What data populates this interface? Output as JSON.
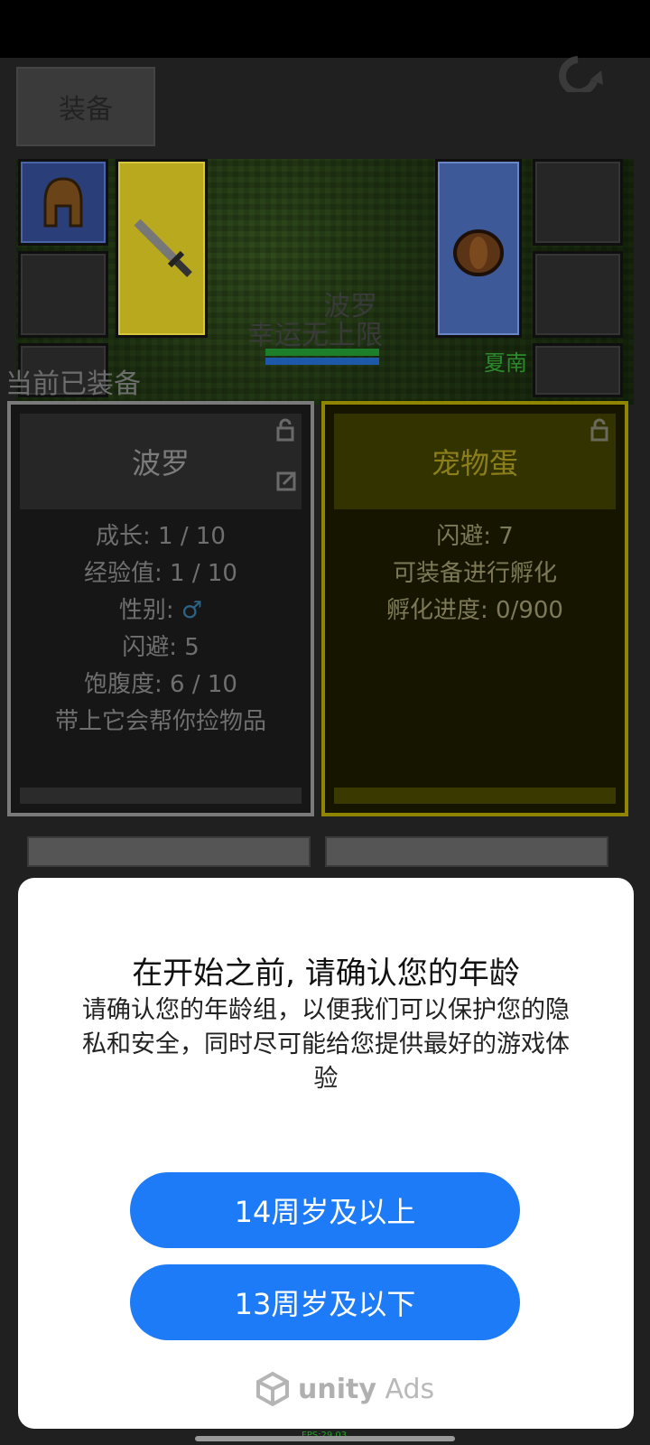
{
  "header": {
    "equip_tab_label": "装备"
  },
  "scene": {
    "pet_name": "波罗",
    "player_title": "幸运无上限",
    "npc_name": "夏南"
  },
  "equipped_label": "当前已装备",
  "pet_card": {
    "title": "波罗",
    "lines": [
      "成长: 1 / 10",
      "经验值: 1 / 10",
      "性别: ",
      "闪避: 5",
      "饱腹度: 6 / 10",
      "带上它会帮你捡物品"
    ],
    "gender_symbol": "♂"
  },
  "egg_card": {
    "title": "宠物蛋",
    "lines": [
      "闪避: 7",
      "可装备进行孵化",
      "孵化进度: 0/900"
    ]
  },
  "age_dialog": {
    "title": "在开始之前, 请确认您的年龄",
    "description": "请确认您的年龄组，以便我们可以保护您的隐私和安全，同时尽可能给您提供最好的游戏体验",
    "button_14_plus": "14周岁及以上",
    "button_13_under": "13周岁及以下",
    "ads_brand_unity": "unity",
    "ads_brand_ads": "Ads"
  },
  "fps_text": "FPS:29.03",
  "colors": {
    "accent_blue": "#1d7bf7",
    "npc_green": "#2c8a2c"
  },
  "icons": [
    "refresh-icon",
    "lock-icon",
    "share-icon",
    "unity-logo-icon"
  ]
}
